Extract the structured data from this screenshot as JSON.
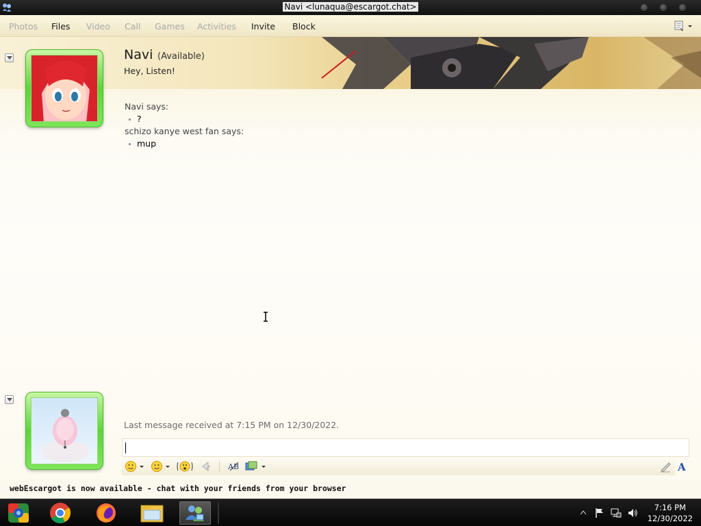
{
  "window": {
    "title": "Navi <lunaqua@escargot.chat>"
  },
  "menu": {
    "items": [
      {
        "label": "Photos",
        "enabled": false
      },
      {
        "label": "Files",
        "enabled": true
      },
      {
        "label": "Video",
        "enabled": false
      },
      {
        "label": "Call",
        "enabled": false
      },
      {
        "label": "Games",
        "enabled": false
      },
      {
        "label": "Activities",
        "enabled": false
      },
      {
        "label": "Invite",
        "enabled": true
      },
      {
        "label": "Block",
        "enabled": true
      }
    ]
  },
  "contact": {
    "name": "Navi",
    "status": "(Available)",
    "personal_message": "Hey, Listen!"
  },
  "conversation": [
    {
      "sender": "Navi says:",
      "messages": [
        "?"
      ]
    },
    {
      "sender": "schizo kanye west fan says:",
      "messages": [
        "mup"
      ]
    }
  ],
  "last_message": "Last message received at 7:15 PM on 12/30/2022.",
  "input": {
    "value": ""
  },
  "input_toolbar": {
    "buttons": [
      "emoticon-icon",
      "wink-icon",
      "nudge-icon",
      "voice-clip-icon",
      "spell-check-icon",
      "background-icon",
      "handwriting-icon",
      "font-icon"
    ]
  },
  "footer": {
    "ad_text": "webEscargot is now available - chat with your friends from your browser"
  },
  "taskbar": {
    "apps": [
      "colorful-app-icon",
      "chrome-icon",
      "firefox-icon",
      "file-explorer-icon",
      "messenger-icon"
    ],
    "time": "7:16 PM",
    "date": "12/30/2022"
  },
  "colors": {
    "avatar_frame": "#5bd63a",
    "menu_bg": "#f5eed3",
    "taskbar": "#111111"
  }
}
